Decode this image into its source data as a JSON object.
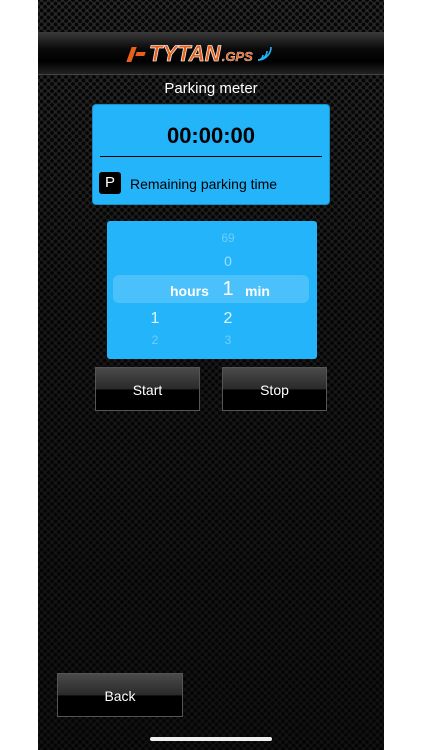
{
  "header": {
    "logo_text": "TYTAN",
    "logo_suffix": ".GPS"
  },
  "page": {
    "title": "Parking meter"
  },
  "timer": {
    "value": "00:00:00",
    "badge": "P",
    "caption": "Remaining parking time"
  },
  "picker": {
    "hours_label": "hours",
    "min_label": "min",
    "hours_above": "",
    "hours_selected": "",
    "hours_below_1": "1",
    "hours_below_2": "2",
    "min_above_2": "69",
    "min_above_1": "0",
    "min_selected": "1",
    "min_below_1": "2",
    "min_below_2": "3"
  },
  "buttons": {
    "start": "Start",
    "stop": "Stop",
    "back": "Back"
  },
  "colors": {
    "accent": "#23b4fa",
    "brand": "#e8611a"
  }
}
